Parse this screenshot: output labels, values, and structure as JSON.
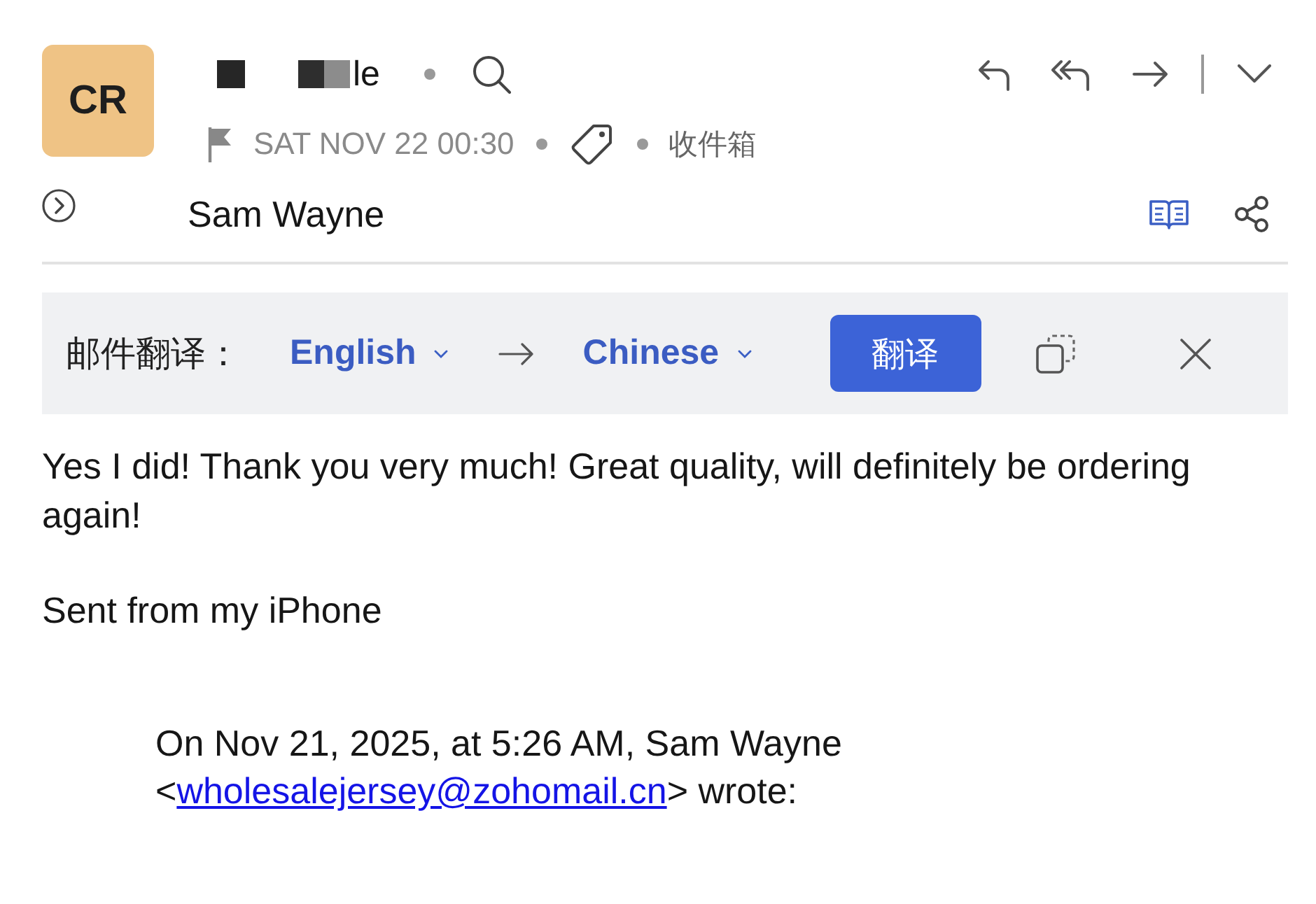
{
  "message": {
    "avatar_initials": "CR",
    "subject": "le",
    "date": "SAT NOV 22 00:30",
    "folder": "收件箱",
    "sender": "Sam Wayne"
  },
  "translation_bar": {
    "label": "邮件翻译：",
    "source_language": "English",
    "target_language": "Chinese",
    "button": "翻译"
  },
  "body": {
    "paragraphs": [
      "Yes I did! Thank you very much! Great quality, will definitely be ordering again!",
      "Sent from my iPhone"
    ],
    "quote": {
      "text_before": "On Nov 21, 2025, at 5:26 AM, Sam Wayne <",
      "email": "wholesalejersey@zohomail.cn",
      "text_after": "> wrote:"
    }
  }
}
